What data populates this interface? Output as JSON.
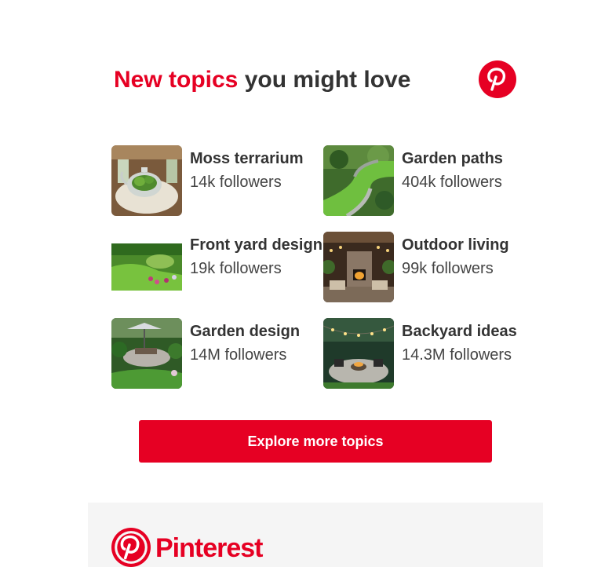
{
  "heading": {
    "accent": "New topics",
    "rest": " you might love"
  },
  "brand": {
    "accent_color": "#e60023",
    "logo_icon": "pinterest-logo-icon",
    "wordmark": "Pinterest"
  },
  "topics": [
    {
      "name": "Moss terrarium",
      "followers": "14k followers"
    },
    {
      "name": "Garden paths",
      "followers": "404k followers"
    },
    {
      "name": "Front yard design",
      "followers": "19k followers"
    },
    {
      "name": "Outdoor living",
      "followers": "99k followers"
    },
    {
      "name": "Garden design",
      "followers": "14M followers"
    },
    {
      "name": "Backyard ideas",
      "followers": "14.3M followers"
    }
  ],
  "cta": {
    "label": "Explore more topics"
  }
}
